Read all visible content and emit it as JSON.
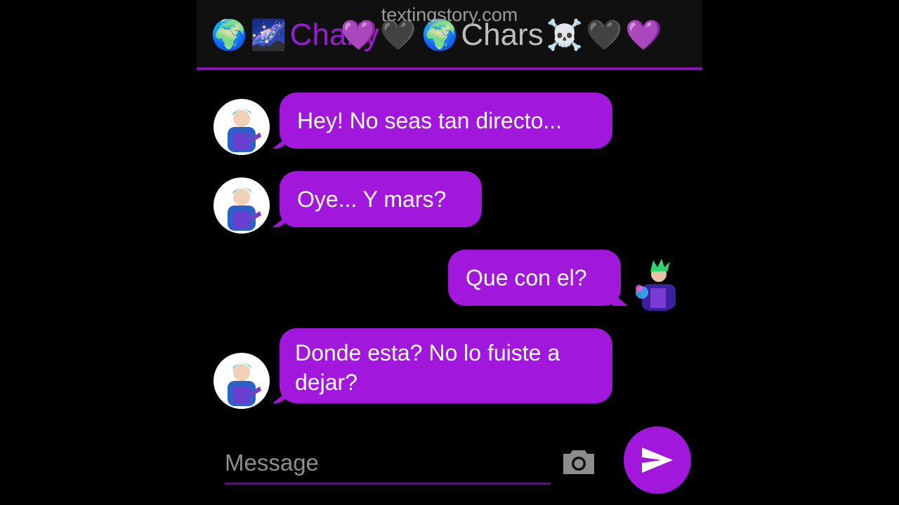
{
  "watermark": "textingstory.com",
  "header": {
    "title_left": "Charly",
    "title_right": "Chars",
    "emoji_left": [
      "🌍",
      "🌌"
    ],
    "emoji_mid": [
      "💜",
      "🖤",
      "🌌",
      "🌍"
    ],
    "emoji_right": [
      "☠️",
      "🖤",
      "💜"
    ]
  },
  "messages": [
    {
      "side": "in",
      "text": "Hey! No seas tan directo..."
    },
    {
      "side": "in",
      "text": "Oye... Y mars?"
    },
    {
      "side": "out",
      "text": "Que con el?"
    },
    {
      "side": "in",
      "text": "Donde esta? No lo fuiste a dejar?"
    }
  ],
  "composer": {
    "placeholder": "Message",
    "camera_icon": "camera-icon",
    "send_icon": "send-icon"
  },
  "colors": {
    "bubble": "#a117db",
    "accent_line": "#8a0fb0",
    "background": "#000000"
  }
}
